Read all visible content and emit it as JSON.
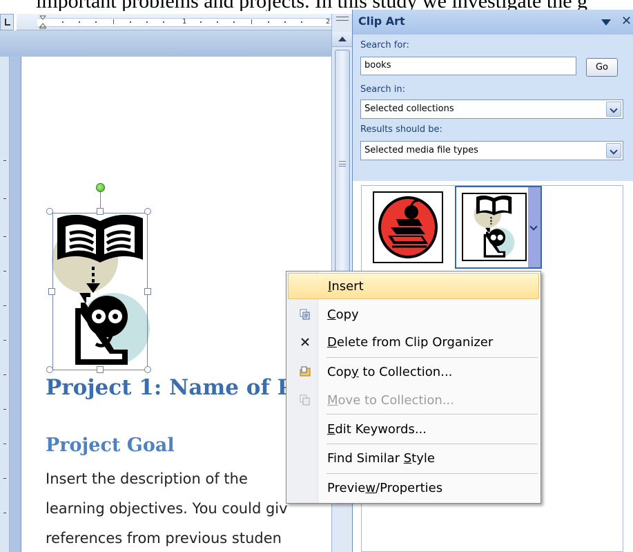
{
  "top_text": "important problems and projects. In this study we investigate the g",
  "ruler": {
    "numbers": [
      "1",
      "2"
    ]
  },
  "document": {
    "heading1": "Project 1: Name of P",
    "heading2": "Project Goal",
    "body_lines": [
      "Insert the description of the",
      "learning objectives. You could giv",
      "references from previous studen"
    ]
  },
  "clip_art_pane": {
    "title": "Clip Art",
    "search_label": "Search for:",
    "search_value": "books",
    "go_label": "Go",
    "search_in_label": "Search in:",
    "search_in_value": "Selected collections",
    "results_label": "Results should be:",
    "results_value": "Selected media file types"
  },
  "context_menu": {
    "items": [
      {
        "pre": "",
        "u": "I",
        "post": "nsert",
        "highlighted": true,
        "disabled": false,
        "icon": ""
      },
      {
        "pre": "",
        "u": "C",
        "post": "opy",
        "highlighted": false,
        "disabled": false,
        "icon": "copy-icon"
      },
      {
        "pre": "",
        "u": "D",
        "post": "elete from Clip Organizer",
        "highlighted": false,
        "disabled": false,
        "icon": "delete-x-icon"
      },
      {
        "pre": "Cop",
        "u": "y",
        "post": " to Collection...",
        "highlighted": false,
        "disabled": false,
        "icon": "copy-to-collection-icon"
      },
      {
        "pre": "",
        "u": "M",
        "post": "ove to Collection...",
        "highlighted": false,
        "disabled": true,
        "icon": "move-to-collection-icon"
      },
      {
        "pre": "",
        "u": "E",
        "post": "dit Keywords...",
        "highlighted": false,
        "disabled": false,
        "icon": ""
      },
      {
        "pre": "Find Similar ",
        "u": "S",
        "post": "tyle",
        "highlighted": false,
        "disabled": false,
        "icon": ""
      },
      {
        "pre": "Previe",
        "u": "w",
        "post": "/Properties",
        "highlighted": false,
        "disabled": false,
        "icon": ""
      }
    ]
  },
  "colors": {
    "heading1": "#3b6eae",
    "heading2": "#4f82c0",
    "pane_title": "#15386e",
    "menu_highlight": "#ffe29a"
  }
}
